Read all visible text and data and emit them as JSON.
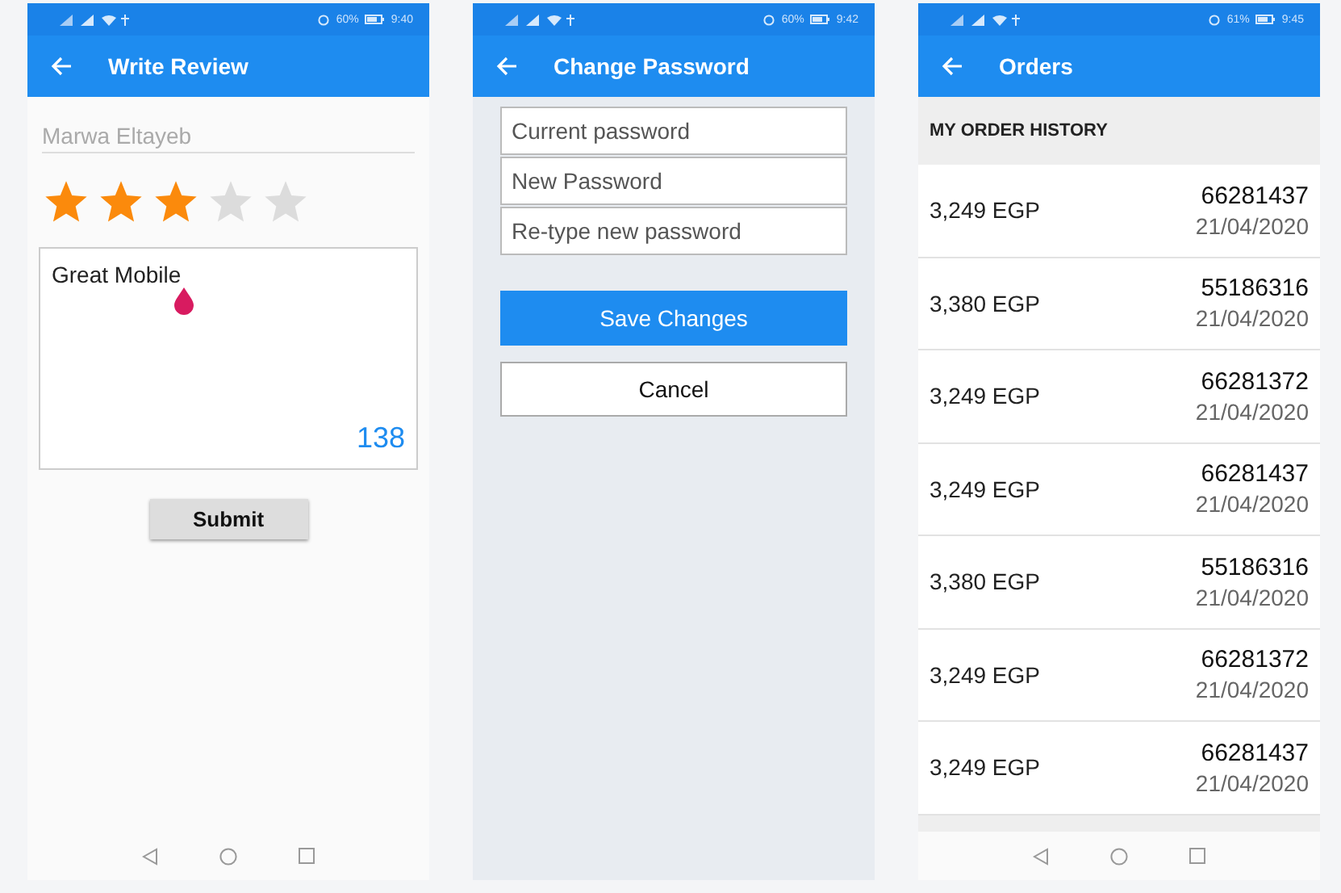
{
  "screens": [
    {
      "kind": "review",
      "status": {
        "battery": "60%",
        "time": "9:40"
      },
      "title": "Write Review",
      "name_placeholder": "Marwa Eltayeb",
      "stars": 3,
      "review": {
        "value": "Great Mobile",
        "counter": "138"
      },
      "submit": "Submit",
      "nav_bar": true
    },
    {
      "kind": "password",
      "status": {
        "battery": "60%",
        "time": "9:42"
      },
      "title": "Change Password",
      "fields": [
        {
          "placeholder": "Current password"
        },
        {
          "placeholder": "New Password"
        },
        {
          "placeholder": "Re-type new password"
        }
      ],
      "save": "Save Changes",
      "cancel": "Cancel",
      "nav_bar": false
    },
    {
      "kind": "orders",
      "status": {
        "battery": "61%",
        "time": "9:45"
      },
      "title": "Orders",
      "section": "MY ORDER HISTORY",
      "orders": [
        {
          "amount": "3,249 EGP",
          "number": "66281437",
          "date": "21/04/2020"
        },
        {
          "amount": "3,380 EGP",
          "number": "55186316",
          "date": "21/04/2020"
        },
        {
          "amount": "3,249 EGP",
          "number": "66281372",
          "date": "21/04/2020"
        },
        {
          "amount": "3,249 EGP",
          "number": "66281437",
          "date": "21/04/2020"
        },
        {
          "amount": "3,380 EGP",
          "number": "55186316",
          "date": "21/04/2020"
        },
        {
          "amount": "3,249 EGP",
          "number": "66281372",
          "date": "21/04/2020"
        },
        {
          "amount": "3,249 EGP",
          "number": "66281437",
          "date": "21/04/2020"
        }
      ],
      "nav_bar": true
    }
  ]
}
